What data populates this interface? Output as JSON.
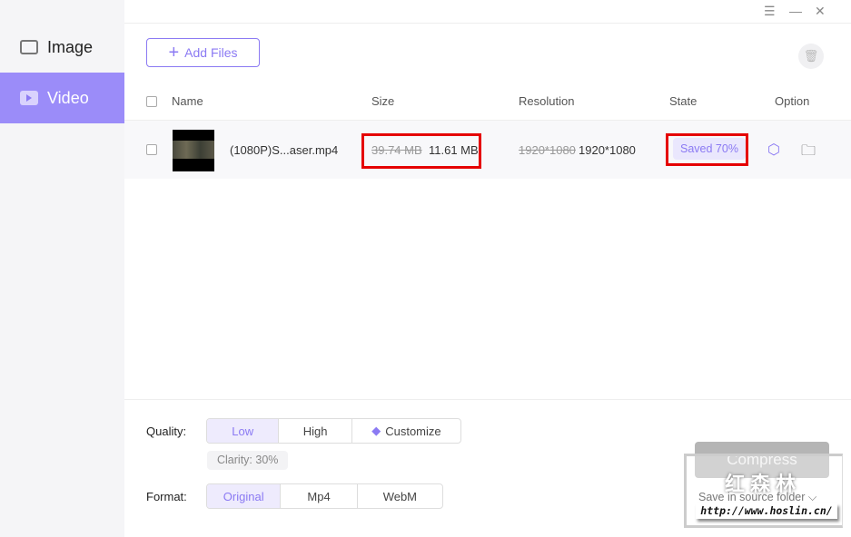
{
  "sidebar": {
    "items": [
      {
        "label": "Image",
        "icon": "image-icon",
        "active": false
      },
      {
        "label": "Video",
        "icon": "video-icon",
        "active": true
      }
    ]
  },
  "window": {
    "menu_icon": "☰",
    "minimize_icon": "—",
    "close_icon": "✕"
  },
  "toolbar": {
    "add_files": "Add Files",
    "add_icon": "+",
    "trash_icon": "🗑"
  },
  "table": {
    "headers": {
      "name": "Name",
      "size": "Size",
      "resolution": "Resolution",
      "state": "State",
      "option": "Option"
    },
    "rows": [
      {
        "name": "(1080P)S...aser.mp4",
        "size_original": "39.74 MB",
        "size_new": "11.61 MB",
        "res_original": "1920*1080",
        "res_new": "1920*1080",
        "state": "Saved 70%"
      }
    ]
  },
  "settings": {
    "quality_label": "Quality:",
    "quality_options": [
      "Low",
      "High",
      "Customize"
    ],
    "quality_selected": "Low",
    "clarity": "Clarity: 30%",
    "format_label": "Format:",
    "format_options": [
      "Original",
      "Mp4",
      "WebM"
    ],
    "format_selected": "Original"
  },
  "actions": {
    "compress": "Compress",
    "save_location": "Save in source folder",
    "chevron": "⌵"
  },
  "watermark": {
    "cn": "红森林",
    "url": "http://www.hoslin.cn/"
  },
  "colors": {
    "accent": "#8b7af3",
    "sidebar_active": "#9b8cf9",
    "highlight_box": "#e50000"
  }
}
